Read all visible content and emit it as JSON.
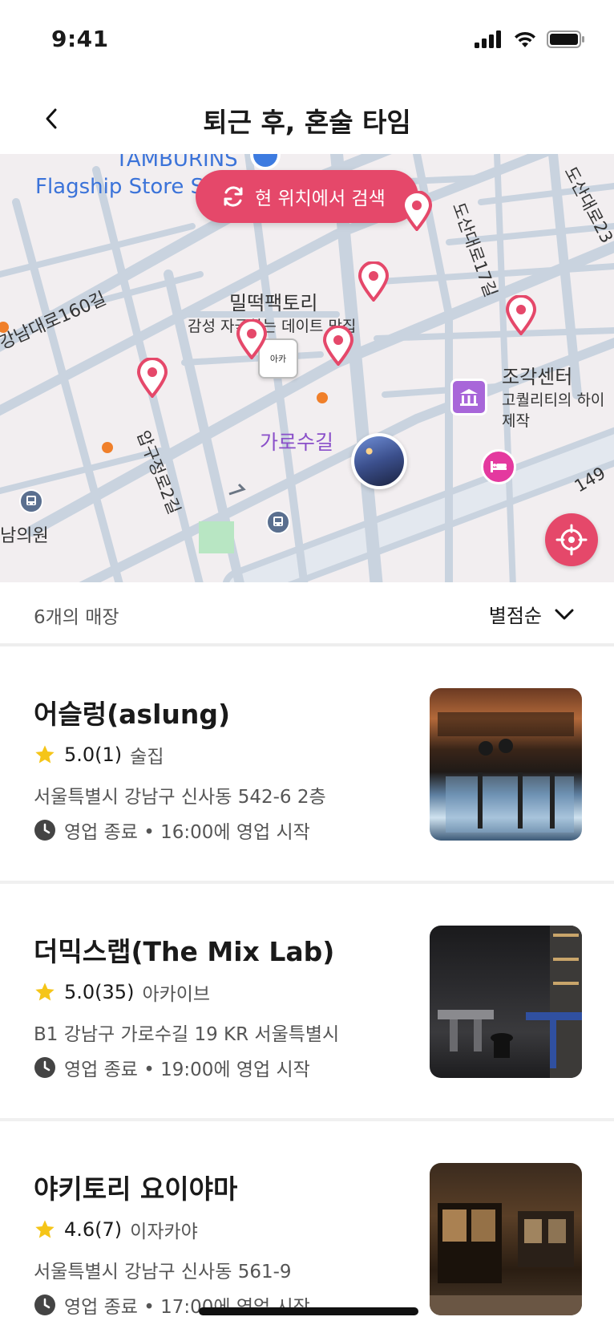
{
  "status_bar": {
    "time": "9:41"
  },
  "header": {
    "title": "퇴근 후, 혼술 타임"
  },
  "map": {
    "search_here_label": "현 위치에서 검색",
    "labels": {
      "tamburins_1": "TAMBURINS",
      "tamburins_2": "Flagship Store S",
      "gangnam_daero": "강남대로160길",
      "milddeok": "밀떡팩토리",
      "milddeok_sub": "감성 자극하는 데이트 맛집",
      "apgujeong": "압구정로2길",
      "garosu": "가로수길",
      "dosan17": "도산대로17길",
      "dosan23": "도산대로23",
      "sculpture": "조각센터",
      "sculpture_sub1": "고퀄리티의 하이",
      "sculpture_sub2": "제작",
      "clinic": "남의원",
      "road_149": "149",
      "shop_sign": "아카"
    }
  },
  "list": {
    "count_label": "6개의 매장",
    "sort_label": "별점순"
  },
  "stores": [
    {
      "name": "어슬렁(aslung)",
      "rating": "5.0(1)",
      "category": "술집",
      "address": "서울특별시 강남구 신사동 542-6 2층",
      "hours": "영업 종료 • 16:00에 영업 시작"
    },
    {
      "name": "더믹스랩(The Mix Lab)",
      "rating": "5.0(35)",
      "category": "아카이브",
      "address": "B1 강남구 가로수길 19 KR 서울특별시",
      "hours": "영업 종료 • 19:00에 영업 시작"
    },
    {
      "name": "야키토리 요이야마",
      "rating": "4.6(7)",
      "category": "이자카야",
      "address": "서울특별시 강남구 신사동 561-9",
      "hours": "영업 종료 • 17:00에 영업 시작"
    }
  ],
  "colors": {
    "accent": "#e5486a",
    "star": "#f5c518",
    "map_bg": "#f2eef0",
    "map_road": "#c9d3df"
  },
  "icons": [
    "back-icon",
    "refresh-icon",
    "map-pin-icon",
    "crosshair-icon",
    "chevron-down-icon",
    "star-icon",
    "clock-icon",
    "bus-icon",
    "museum-icon",
    "hotel-icon"
  ]
}
